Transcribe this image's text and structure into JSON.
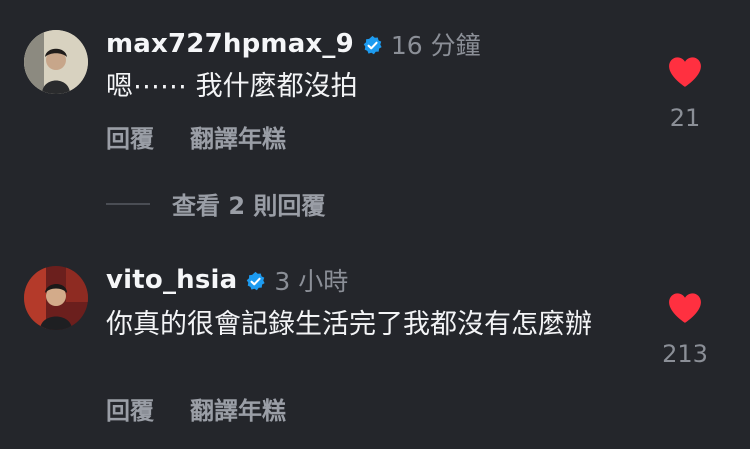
{
  "comments": [
    {
      "username": "max727hpmax_9",
      "time": "16 分鐘",
      "text": "嗯⋯⋯ 我什麼都沒拍",
      "reply_label": "回覆",
      "translate_label": "翻譯年糕",
      "like_count": "21",
      "view_replies": "查看 2 則回覆"
    },
    {
      "username": "vito_hsia",
      "time": "3 小時",
      "text": "你真的很會記錄生活完了我都沒有怎麼辦",
      "reply_label": "回覆",
      "translate_label": "翻譯年糕",
      "like_count": "213"
    }
  ],
  "colors": {
    "background": "#24262b",
    "verified": "#1d9bf0",
    "heart": "#ff3040",
    "muted": "#8b8f97"
  },
  "icons": [
    "verified-badge-icon",
    "heart-icon"
  ]
}
